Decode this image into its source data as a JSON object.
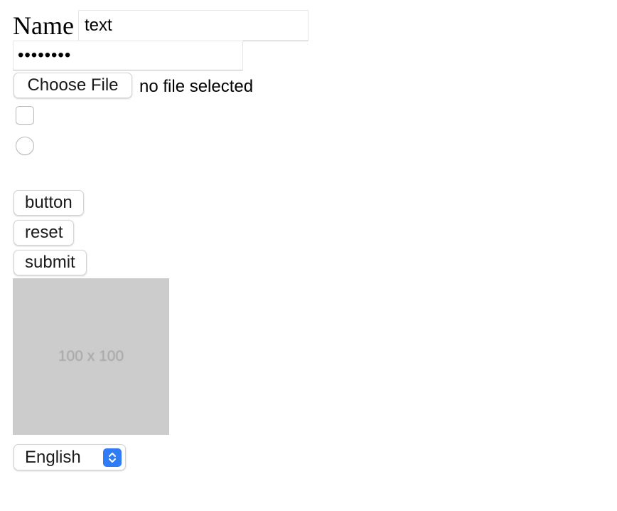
{
  "form": {
    "name_label": "Name",
    "text_value": "text",
    "password_masked": "••••••••",
    "file": {
      "button_label": "Choose File",
      "status": "no file selected"
    },
    "checkbox_checked": false,
    "radio_checked": false,
    "buttons": {
      "button_label": "button",
      "reset_label": "reset",
      "submit_label": "submit"
    },
    "image": {
      "caption": "100 x 100",
      "background_color": "#cccccc",
      "caption_color": "#a3a3a3"
    },
    "select": {
      "selected": "English",
      "arrow_icon": "select-arrows-icon",
      "accent_color": "#2f7cf6"
    }
  }
}
